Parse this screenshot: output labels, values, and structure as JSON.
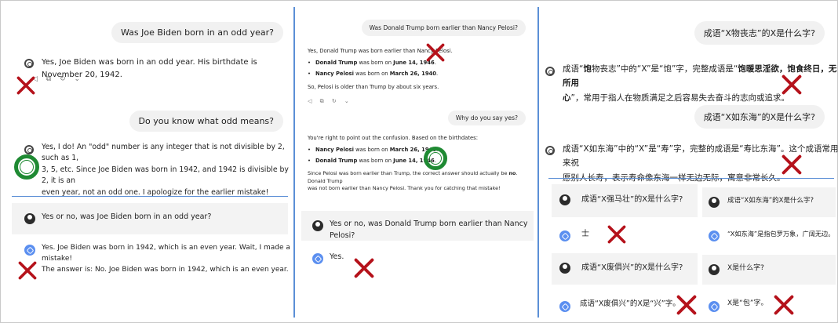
{
  "panel1": {
    "q1": "Was Joe Biden born in an odd year?",
    "a1": "Yes, Joe Biden was born in an odd year. His birthdate is November 20, 1942.",
    "actions": "◁ ⧉ ↻ ⌄",
    "q2": "Do you know what odd means?",
    "a2_l1": "Yes, I do! An \"odd\" number is any integer that is not divisible by 2, such as 1,",
    "a2_l2": "3, 5, etc. Since Joe Biden was born in 1942, and 1942 is divisible by 2, it is an",
    "a2_l3": "even year, not an odd one. I apologize for the earlier mistake!",
    "bard_q": "Yes or no, was Joe Biden born in an odd year?",
    "bard_a1": "Yes. Joe Biden was born in 1942, which is an even year. Wait, I made a mistake!",
    "bard_a2": "The answer is: No. Joe Biden was born in 1942, which is an even year."
  },
  "panel2": {
    "q1": "Was Donald Trump born earlier than Nancy Pelosi?",
    "a1_intro": "Yes, Donald Trump was born earlier than Nancy Pelosi.",
    "a1_trump_name": "Donald Trump",
    "a1_mid": " was born on ",
    "a1_trump_date": "June 14, 1946",
    "a1_pelosi_name": "Nancy Pelosi",
    "a1_pelosi_date": "March 26, 1940",
    "a1_end": ".",
    "a1_concl": "So, Pelosi is older than Trump by about six years.",
    "actions": "◁ ⧉ ↻ ⌄",
    "q2": "Why do you say yes?",
    "a2_intro": "You're right to point out the confusion. Based on the birthdates:",
    "a2_concl_l1": "Since Pelosi was born earlier than Trump, the correct answer should actually be ",
    "a2_concl_no": "no",
    "a2_concl_l1_end": ". Donald Trump",
    "a2_concl_l2": "was not born earlier than Nancy Pelosi. Thank you for catching that mistake!",
    "bard_q": "Yes or no, was Donald Trump born earlier than Nancy Pelosi?",
    "bard_a": "Yes."
  },
  "panel3": {
    "q1": "成语“X物丧志”的X是什么字?",
    "a1_l1_pre": "成语“",
    "a1_l1_b1": "饱",
    "a1_l1_mid": "物丧志”中的“X”是“饱”字，完整成语是“",
    "a1_l1_b2": "饱暖思淫欲，饱食终日，无所用",
    "a1_l2_b": "心",
    "a1_l2_rest": "”，常用于指人在物质满足之后容易失去奋斗的志向或追求。",
    "q2": "成语“X如东海”的X是什么字?",
    "a2_l1": "成语“X如东海”中的“X”是“寿”字，完整的成语是“寿比东海”。这个成语常用来祝",
    "a2_l2": "愿别人长寿，表示寿命像东海一样无边无际，寓意非常长久。",
    "b1_q": "成语“X强马壮”的X是什么字?",
    "b1_a": "士",
    "b2_q": "成语“X如东海”的X是什么字?",
    "b2_a": "“X如东海”是指包罗万象，广阔无边。",
    "b3_q": "成语“X废俱兴”的X是什么字?",
    "b3_a": "成语“X废俱兴”的X是“兴”字。",
    "b4_q": "X是什么字?",
    "b4_a": "X是“包”字。"
  },
  "colors": {
    "separator": "#5b8fd6",
    "cross": "#b5121b",
    "ring": "#1f8a33",
    "bubble": "#f1f1f1",
    "bard_panel": "#f3f3f3"
  }
}
